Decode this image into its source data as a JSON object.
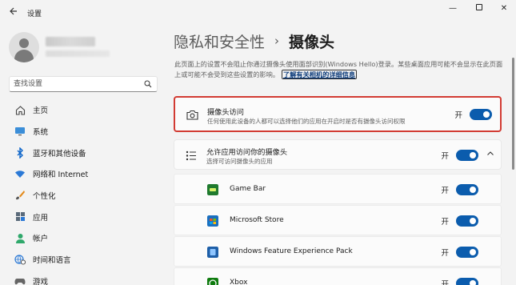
{
  "window": {
    "title": "设置",
    "back_icon": "back-arrow-icon",
    "minimize_glyph": "—",
    "close_glyph": "✕"
  },
  "search": {
    "placeholder": "查找设置"
  },
  "sidebar": {
    "items": [
      {
        "label": "主页",
        "icon": "home-icon"
      },
      {
        "label": "系统",
        "icon": "monitor-icon"
      },
      {
        "label": "蓝牙和其他设备",
        "icon": "bluetooth-icon"
      },
      {
        "label": "网络和 Internet",
        "icon": "wifi-icon"
      },
      {
        "label": "个性化",
        "icon": "brush-icon"
      },
      {
        "label": "应用",
        "icon": "apps-icon"
      },
      {
        "label": "帐户",
        "icon": "account-icon"
      },
      {
        "label": "时间和语言",
        "icon": "globe-clock-icon"
      },
      {
        "label": "游戏",
        "icon": "gamepad-icon"
      }
    ]
  },
  "breadcrumb": {
    "parent": "隐私和安全性",
    "separator": "›",
    "current": "摄像头"
  },
  "intro": {
    "text": "此页面上的设置不会阻止你通过摄像头使用面部识别(Windows Hello)登录。某些桌面应用可能不会显示在此页面上或可能不会受到这些设置的影响。",
    "link": "了解有关相机的详细信息"
  },
  "camera_access": {
    "title": "摄像头访问",
    "description": "任何使用此设备的人都可以选择他们的应用在开启时是否有摄像头访问权限",
    "state": "开"
  },
  "app_access": {
    "title": "允许应用访问你的摄像头",
    "description": "选择可访问摄像头的应用",
    "state": "开"
  },
  "apps": [
    {
      "name": "Game Bar",
      "state": "开",
      "icon_color": "#1f7a2e"
    },
    {
      "name": "Microsoft Store",
      "state": "开",
      "icon_color": "#1a6fbf"
    },
    {
      "name": "Windows Feature Experience Pack",
      "state": "开",
      "icon_color": "#1e5fa8"
    },
    {
      "name": "Xbox",
      "state": "开",
      "icon_color": "#107c10"
    }
  ],
  "accent_color": "#0b5cad",
  "highlight_color": "#d23b33"
}
